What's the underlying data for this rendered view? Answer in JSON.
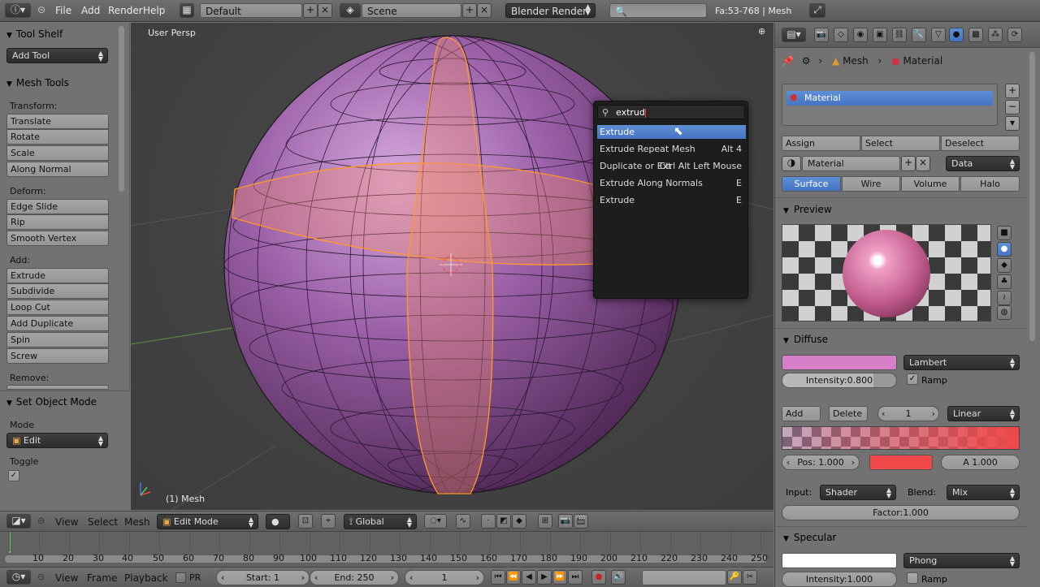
{
  "topbar": {
    "menus": [
      "File",
      "Add",
      "Render",
      "Help"
    ],
    "screen_layout": "Default",
    "scene": "Scene",
    "render_engine": "Blender Render",
    "search_placeholder": "",
    "stats": "Fa:53-768 | Mesh"
  },
  "toolshelf": {
    "title": "Tool Shelf",
    "add_tool": "Add Tool",
    "mesh_tools_title": "Mesh Tools",
    "transform_label": "Transform:",
    "transform": [
      "Translate",
      "Rotate",
      "Scale",
      "Along Normal"
    ],
    "deform_label": "Deform:",
    "deform": [
      "Edge Slide",
      "Rip",
      "Smooth Vertex"
    ],
    "add_label": "Add:",
    "add": [
      "Extrude",
      "Subdivide",
      "Loop Cut",
      "Add Duplicate",
      "Spin",
      "Screw"
    ],
    "remove_label": "Remove:",
    "set_object_mode_title": "Set Object Mode",
    "mode_label": "Mode",
    "mode_value": "Edit",
    "toggle_label": "Toggle"
  },
  "viewport": {
    "view_name": "User Persp",
    "object_label": "(1) Mesh"
  },
  "search_popup": {
    "query": "extrud",
    "results": [
      {
        "label": "Extrude",
        "shortcut": ""
      },
      {
        "label": "Extrude Repeat Mesh",
        "shortcut": "Alt 4"
      },
      {
        "label": "Duplicate or Ext",
        "shortcut": "Ctrl Alt Left Mouse"
      },
      {
        "label": "Extrude Along Normals",
        "shortcut": "E"
      },
      {
        "label": "Extrude",
        "shortcut": "E"
      }
    ]
  },
  "properties": {
    "breadcrumb": [
      "Mesh",
      "Material"
    ],
    "material_slot": "Material",
    "assign": "Assign",
    "select": "Select",
    "deselect": "Deselect",
    "material_name": "Material",
    "link": "Data",
    "tabs": [
      "Surface",
      "Wire",
      "Volume",
      "Halo"
    ],
    "preview_title": "Preview",
    "diffuse_title": "Diffuse",
    "diffuse_color": "#d67ec8",
    "diffuse_shader": "Lambert",
    "diffuse_intensity": "Intensity:0.800",
    "ramp_label": "Ramp",
    "ramp_add": "Add",
    "ramp_delete": "Delete",
    "ramp_index": "1",
    "ramp_interp": "Linear",
    "ramp_pos": "Pos: 1.000",
    "ramp_stop_color": "#f04848",
    "ramp_alpha": "A 1.000",
    "input_label": "Input:",
    "input_value": "Shader",
    "blend_label": "Blend:",
    "blend_value": "Mix",
    "factor": "Factor:1.000",
    "specular_title": "Specular",
    "specular_color": "#ffffff",
    "specular_shader": "Phong",
    "specular_intensity": "Intensity:1.000",
    "specular_ramp": "Ramp"
  },
  "view3d_header": {
    "menus": [
      "View",
      "Select",
      "Mesh"
    ],
    "mode": "Edit Mode",
    "orientation": "Global"
  },
  "timeline": {
    "ticks": [
      "10",
      "20",
      "30",
      "40",
      "50",
      "60",
      "70",
      "80",
      "90",
      "100",
      "110",
      "120",
      "130",
      "140",
      "150",
      "160",
      "170",
      "180",
      "190",
      "200",
      "210",
      "220",
      "230",
      "240",
      "250"
    ],
    "menus": [
      "View",
      "Frame",
      "Playback"
    ],
    "pr_label": "PR",
    "start": "Start: 1",
    "end": "End: 250",
    "current": "1"
  }
}
